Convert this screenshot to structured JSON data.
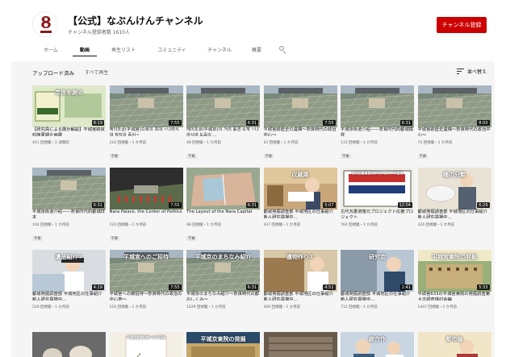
{
  "channel": {
    "title": "【公式】なぶんけんチャンネル",
    "subscribers": "チャンネル登録者数 1610人",
    "subscribe_label": "チャンネル登録"
  },
  "tabs": [
    "ホーム",
    "動画",
    "再生リスト",
    "コミュニティ",
    "チャンネル",
    "概要"
  ],
  "active_tab": "動画",
  "section": {
    "title": "アップロード済み",
    "play_all": "すべて再生",
    "sort_label": "並べ替え"
  },
  "colors": {
    "accent": "#cc0000",
    "page_bg": "#f5f5f5"
  },
  "videos": [
    {
      "title": "【研究員による展示解説】平城宮跡資料館夏期企画展",
      "meta": "441 回視聴・2 週間前",
      "duration": "8:19",
      "cc": "",
      "thumb": "green",
      "overlay": "奈良を測る"
    },
    {
      "title": "헤이조궁(平城宮)으로의 초대 ~나라시대 정치의 중심~",
      "meta": "210 回視聴・1 か月前",
      "duration": "7:55",
      "cc": "字幕",
      "thumb": "aerial",
      "overlay": ""
    },
    {
      "title": "헤이조쿄(平城京)의 거리 풍경 소개 ~나라시대 도읍의 ...",
      "meta": "48 回視聴・1 か月前",
      "duration": "6:31",
      "cc": "字幕",
      "thumb": "aerial",
      "overlay": ""
    },
    {
      "title": "平城宮跡歴史の遺構～奈良時代の政治中心～",
      "meta": "63 回視聴・1 か月前",
      "duration": "7:55",
      "cc": "字幕",
      "thumb": "aerial",
      "overlay": ""
    },
    {
      "title": "平城京街道介绍——奈良时代的都城模样",
      "meta": "133 回視聴・1 か月前",
      "duration": "6:31",
      "cc": "字幕",
      "thumb": "aerial",
      "overlay": ""
    },
    {
      "title": "平城宮跡歴史遺構～奈良時代の政治中心～",
      "meta": "74 回視聴・1 か月前",
      "duration": "8:00",
      "cc": "字幕",
      "thumb": "aerial",
      "overlay": ""
    },
    {
      "title": "平城京街道介绍——奈良时代的都城样本",
      "meta": "104 回視聴・1 か月前",
      "duration": "6:31",
      "cc": "字幕",
      "thumb": "aerial",
      "overlay": ""
    },
    {
      "title": "Nara Palace, the Center of Politics",
      "meta": "124 回視聴・1 か月前",
      "duration": "7:55",
      "cc": "字幕",
      "thumb": "dark",
      "overlay": ""
    },
    {
      "title": "The Layout of the Nara Capital",
      "meta": "98 回視聴・1 か月前",
      "duration": "6:31",
      "cc": "字幕",
      "thumb": "map",
      "overlay": ""
    },
    {
      "title": "都城発掘調査部 平城地区の仕事紹介 新人研究員場中...",
      "meta": "437 回視聴・1 か月前",
      "duration": "5:07",
      "cc": "",
      "thumb": "storage",
      "overlay": "収蔵庫"
    },
    {
      "title": "古代瓦書道復元プロジェクト応援プロジェクト",
      "meta": "764 回視聴・1 か月前",
      "duration": "12:04",
      "cc": "",
      "thumb": "project",
      "overlay": "古代瓦書道復元プロジェクトの歴史"
    },
    {
      "title": "都城発掘調査部 平城地区の仕事紹介 新人研究員場中...",
      "meta": "326 回視聴・1 か月前",
      "duration": "6:29",
      "cc": "",
      "thumb": "lab",
      "overlay": "種の分類"
    },
    {
      "title": "都城発掘調査部 平城地区の仕事紹介 新人研究員場中...",
      "meta": "529 回視聴・1 か月前",
      "duration": "4:19",
      "cc": "",
      "thumb": "person",
      "overlay": "遺品紹介②"
    },
    {
      "title": "平城宮への御招待～奈良時代の政治の中心地～",
      "meta": "516 回視聴・1 か月前",
      "duration": "7:55",
      "cc": "",
      "thumb": "aerial",
      "overlay": "平城宮へのご招待"
    },
    {
      "title": "平城京のまちなみ紹介～奈良時代の都のしくみ～",
      "meta": "1229 回視聴・1 か月前",
      "duration": "6:31",
      "cc": "",
      "thumb": "aerial",
      "overlay": "平城京のまちなみ紹介"
    },
    {
      "title": "都城発掘調査部 平城地区の仕事紹介 新人研究員場中...",
      "meta": "409 回視聴・1 か月前",
      "duration": "4:51",
      "cc": "",
      "thumb": "person2",
      "overlay": "遺物作り①"
    },
    {
      "title": "都城発掘調査部 平城地区の仕事紹介 新人研究員場中...",
      "meta": "712 回視聴・1 か月前",
      "duration": "2:41",
      "cc": "",
      "thumb": "person3",
      "overlay": "研究会"
    },
    {
      "title": "平城宮633の平城宮東院の発掘調査第４次調査検討会編",
      "meta": "1447 回視聴・2 か月前",
      "duration": "5:33",
      "cc": "",
      "thumb": "excav",
      "overlay": "平城宮東院の発掘"
    },
    {
      "title": "",
      "meta": "",
      "duration": "",
      "cc": "",
      "thumb": "pottery",
      "overlay": ""
    },
    {
      "title": "",
      "meta": "",
      "duration": "",
      "cc": "",
      "thumb": "paper",
      "overlay": "平城宮跡資料館へのご招待"
    },
    {
      "title": "",
      "meta": "",
      "duration": "",
      "cc": "",
      "thumb": "excav2",
      "overlay": "平城京東院の発掘"
    },
    {
      "title": "",
      "meta": "",
      "duration": "",
      "cc": "",
      "thumb": "storage2",
      "overlay": ""
    },
    {
      "title": "",
      "meta": "",
      "duration": "",
      "cc": "",
      "thumb": "person4",
      "overlay": "総合作"
    },
    {
      "title": "",
      "meta": "",
      "duration": "",
      "cc": "",
      "thumb": "person5",
      "overlay": "都市論"
    }
  ]
}
